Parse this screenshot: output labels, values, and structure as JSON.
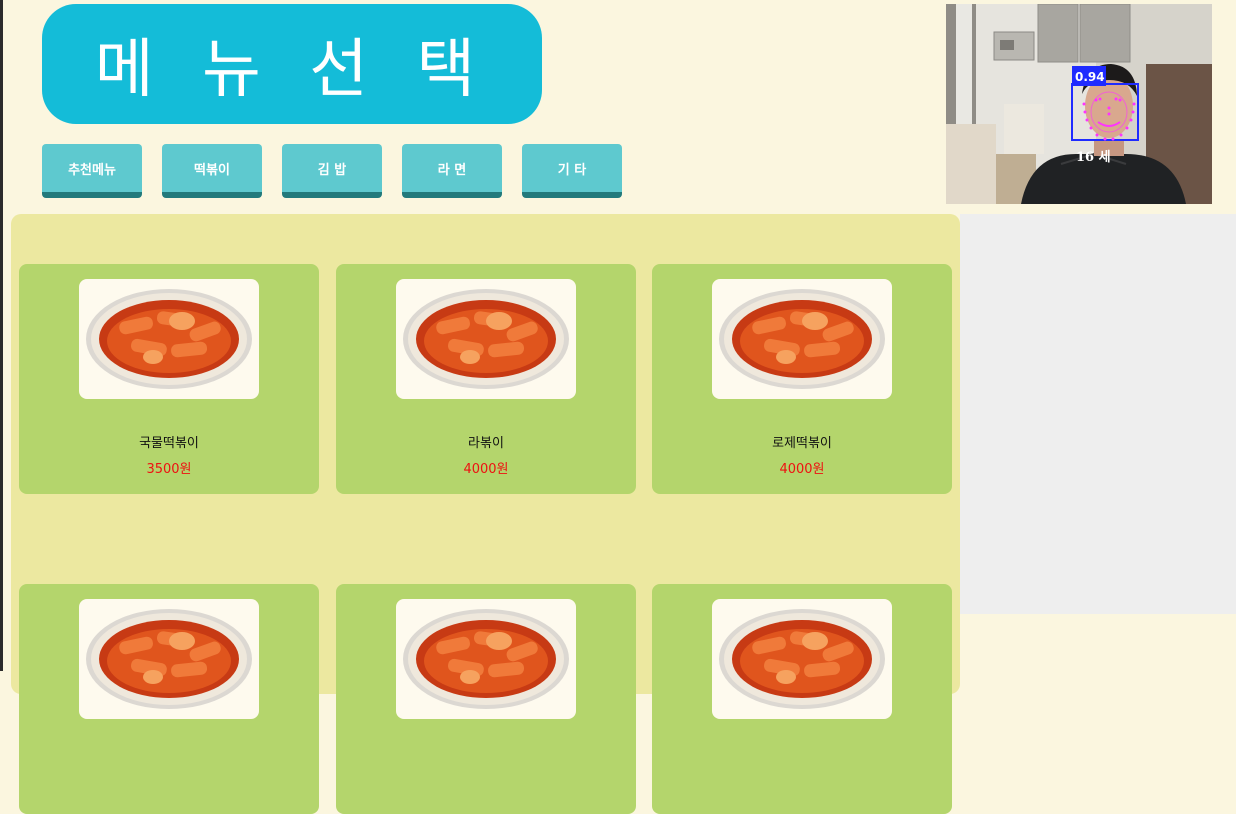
{
  "header": {
    "title": "메 뉴 선 택"
  },
  "tabs": [
    {
      "label": "추천메뉴"
    },
    {
      "label": "떡볶이"
    },
    {
      "label": "김 밥"
    },
    {
      "label": "라 면"
    },
    {
      "label": "기 타"
    }
  ],
  "camera": {
    "confidence": "0.94",
    "age_label": "16 세",
    "box_color": "#1f2bff",
    "landmark_color": "#ff33ff"
  },
  "menu_items": [
    {
      "name": "국물떡볶이",
      "price": "3500원",
      "image": "tteokbokki-plate"
    },
    {
      "name": "라볶이",
      "price": "4000원",
      "image": "tteokbokki-plate"
    },
    {
      "name": "로제떡볶이",
      "price": "4000원",
      "image": "tteokbokki-plate"
    },
    {
      "image": "tteokbokki-plate"
    },
    {
      "image": "tteokbokki-plate"
    },
    {
      "image": "tteokbokki-plate"
    }
  ],
  "colors": {
    "title_bg": "#14bcd8",
    "tab_bg": "#5ec9cf",
    "card_bg": "#b4d56c",
    "panel_bg": "#ece8a0",
    "price": "#ee1111"
  }
}
